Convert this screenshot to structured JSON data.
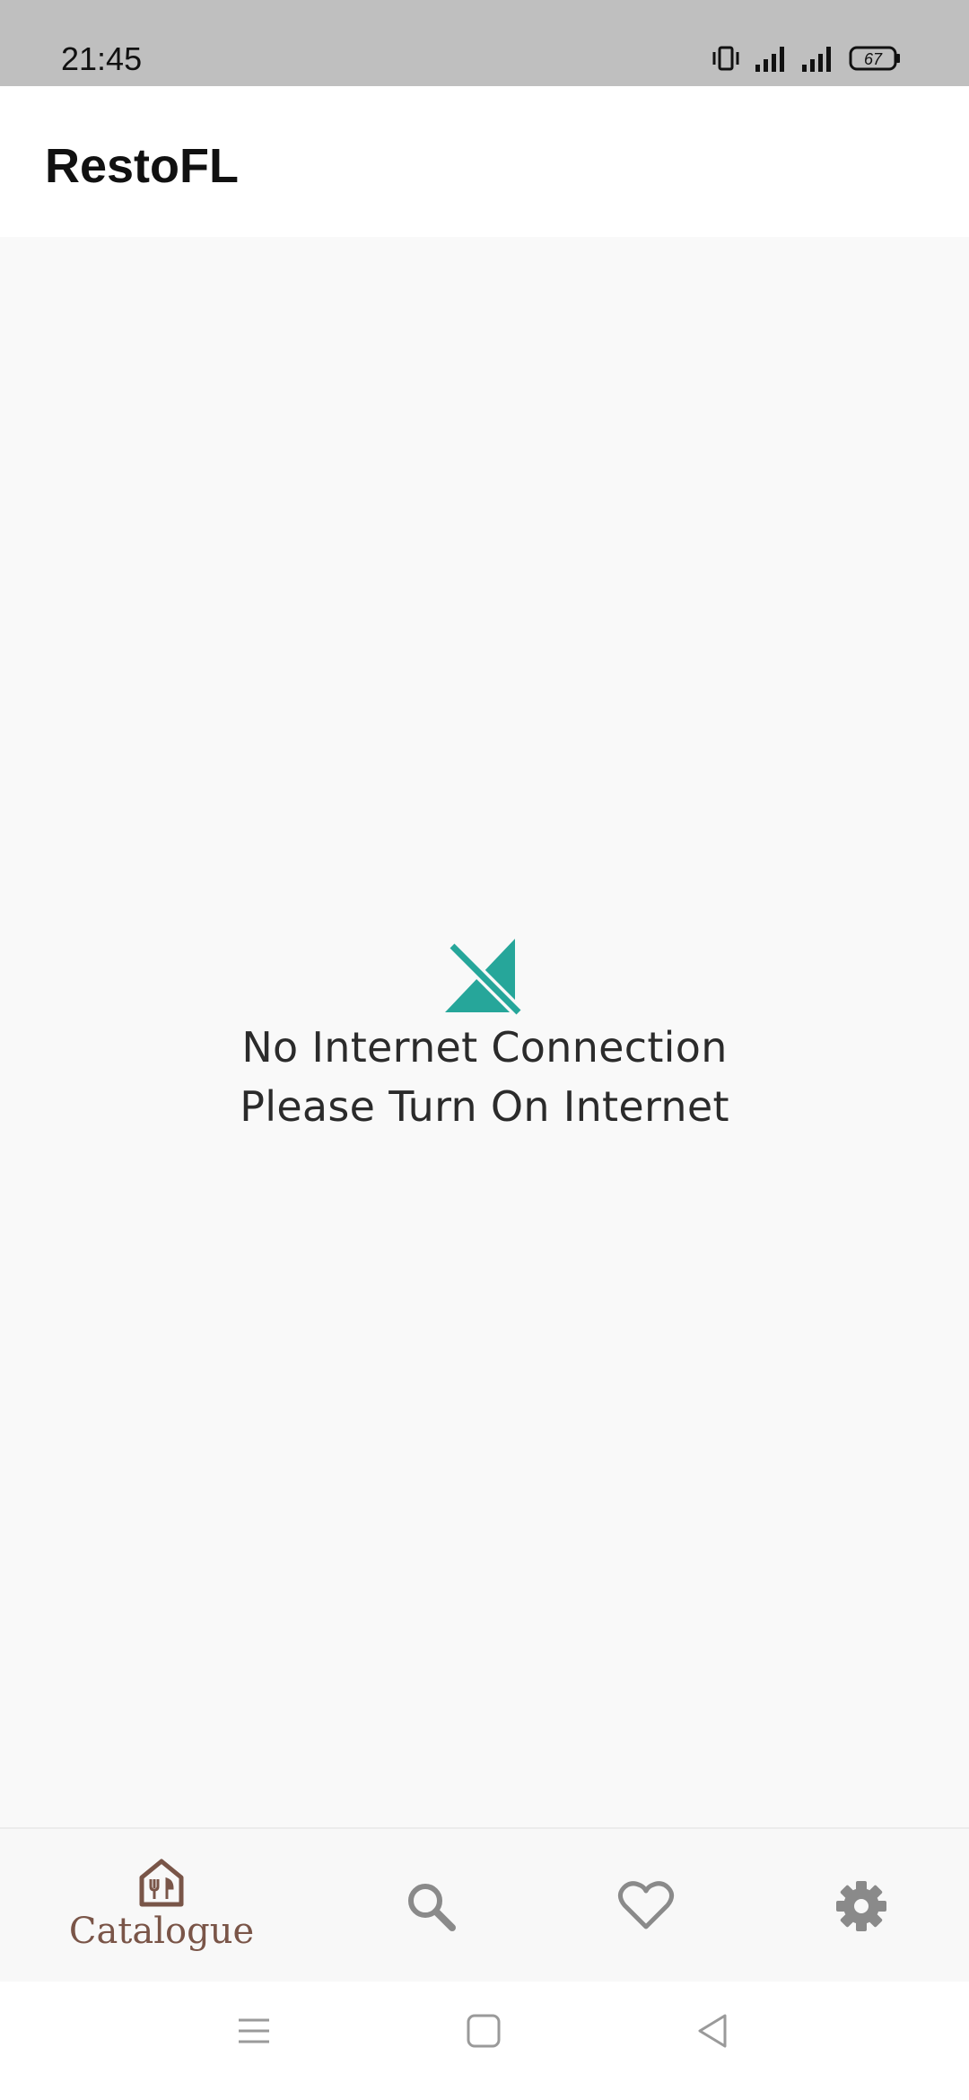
{
  "status_bar": {
    "time": "21:45",
    "battery": "67",
    "icons": [
      "vibrate-icon",
      "signal-icon",
      "signal-icon",
      "battery-icon"
    ]
  },
  "app_bar": {
    "title": "RestoFL"
  },
  "empty_state": {
    "icon": "no-wifi-icon",
    "line1": "No Internet Connection",
    "line2": "Please Turn On Internet",
    "accent": "#26a69a"
  },
  "bottom_nav": {
    "active_color": "#795548",
    "inactive_color": "#8a8a8a",
    "items": [
      {
        "icon": "restaurant-home-icon",
        "label": "Catalogue",
        "active": true
      },
      {
        "icon": "search-icon",
        "label": "",
        "active": false
      },
      {
        "icon": "heart-icon",
        "label": "",
        "active": false
      },
      {
        "icon": "gear-icon",
        "label": "",
        "active": false
      }
    ]
  },
  "system_nav": {
    "buttons": [
      "menu-icon",
      "home-square-icon",
      "back-triangle-icon"
    ]
  }
}
